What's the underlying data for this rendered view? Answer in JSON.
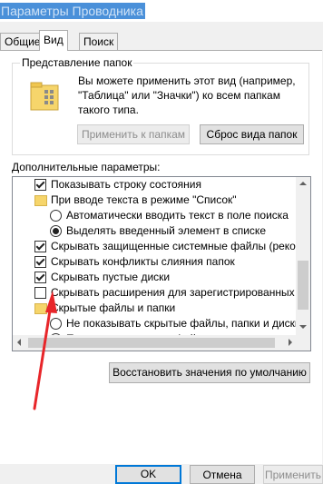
{
  "window": {
    "title": "Параметры Проводника"
  },
  "tabs": [
    {
      "label": "Общие"
    },
    {
      "label": "Вид"
    },
    {
      "label": "Поиск"
    }
  ],
  "folder_view": {
    "label": "Представление папок",
    "description": "Вы можете применить этот вид (например, \"Таблица\" или \"Значки\") ко всем папкам такого типа.",
    "apply_button": "Применить к папкам",
    "reset_button": "Сброс вида папок"
  },
  "advanced": {
    "label": "Дополнительные параметры:",
    "items": [
      {
        "text": "Показывать строку состояния",
        "kind": "checkbox",
        "checked": true
      },
      {
        "text": "При вводе текста в режиме \"Список\"",
        "kind": "folder"
      },
      {
        "text": "Автоматически вводить текст в поле поиска",
        "kind": "radio",
        "checked": false
      },
      {
        "text": "Выделять введенный элемент в списке",
        "kind": "radio",
        "checked": true
      },
      {
        "text": "Скрывать защищенные системные файлы (рекомен",
        "kind": "checkbox",
        "checked": true
      },
      {
        "text": "Скрывать конфликты слияния папок",
        "kind": "checkbox",
        "checked": true
      },
      {
        "text": "Скрывать пустые диски",
        "kind": "checkbox",
        "checked": true
      },
      {
        "text": "Скрывать расширения для зарегистрированных типо",
        "kind": "checkbox",
        "checked": false
      },
      {
        "text": "Скрытые файлы и папки",
        "kind": "folder"
      },
      {
        "text": "Не показывать скрытые файлы, папки и диски",
        "kind": "radio",
        "checked": false
      },
      {
        "text": "Показывать скрытые файлы, папки и диски",
        "kind": "radio",
        "checked": true
      }
    ],
    "restore_button": "Восстановить значения по умолчанию"
  },
  "footer": {
    "ok": "OK",
    "cancel": "Отмена",
    "apply": "Применить"
  },
  "colors": {
    "annotation_arrow": "#e8262a",
    "title_highlight": "#4a90d9"
  }
}
